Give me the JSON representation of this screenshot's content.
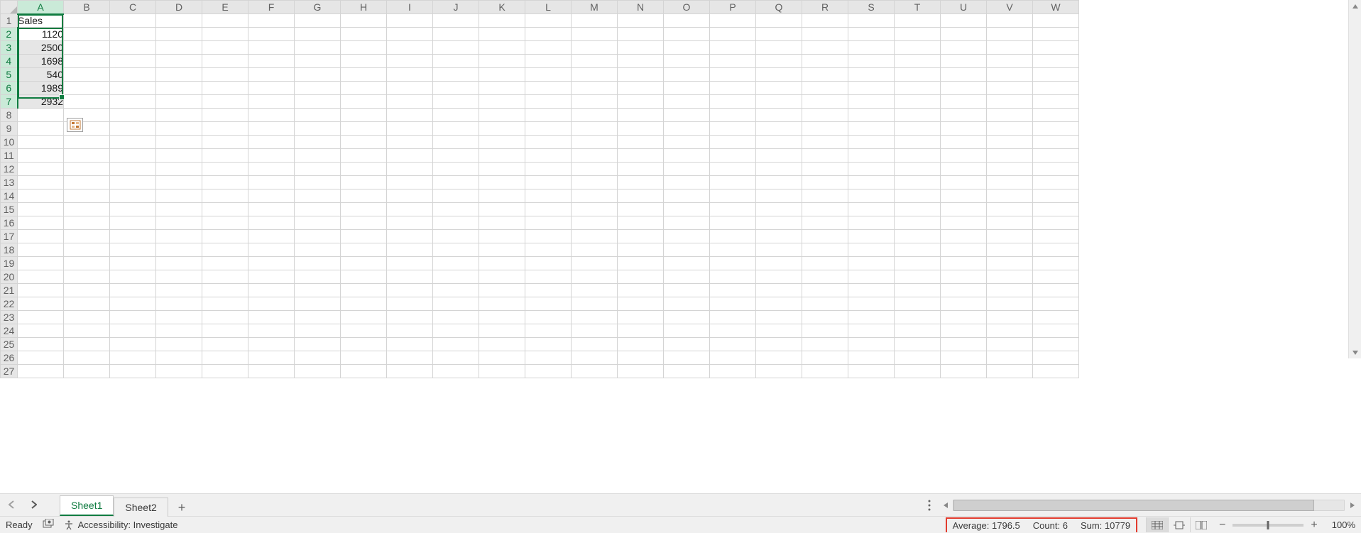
{
  "grid": {
    "columns": [
      "A",
      "B",
      "C",
      "D",
      "E",
      "F",
      "G",
      "H",
      "I",
      "J",
      "K",
      "L",
      "M",
      "N",
      "O",
      "P",
      "Q",
      "R",
      "S",
      "T",
      "U",
      "V",
      "W"
    ],
    "rows": 27,
    "selected_col": "A",
    "selected_rows": [
      2,
      3,
      4,
      5,
      6,
      7
    ],
    "cells": {
      "A1": {
        "v": "Sales",
        "align": "left"
      },
      "A2": {
        "v": "1120",
        "align": "right"
      },
      "A3": {
        "v": "2500",
        "align": "right"
      },
      "A4": {
        "v": "1698",
        "align": "right"
      },
      "A5": {
        "v": "540",
        "align": "right"
      },
      "A6": {
        "v": "1989",
        "align": "right"
      },
      "A7": {
        "v": "2932",
        "align": "right"
      }
    }
  },
  "sheet_bar": {
    "tabs": [
      {
        "label": "Sheet1",
        "active": true
      },
      {
        "label": "Sheet2",
        "active": false
      }
    ],
    "add_label": "+"
  },
  "status": {
    "ready": "Ready",
    "accessibility": "Accessibility: Investigate",
    "aggregate": {
      "average_label": "Average:",
      "average_value": "1796.5",
      "count_label": "Count:",
      "count_value": "6",
      "sum_label": "Sum:",
      "sum_value": "10779"
    },
    "zoom": "100%"
  }
}
